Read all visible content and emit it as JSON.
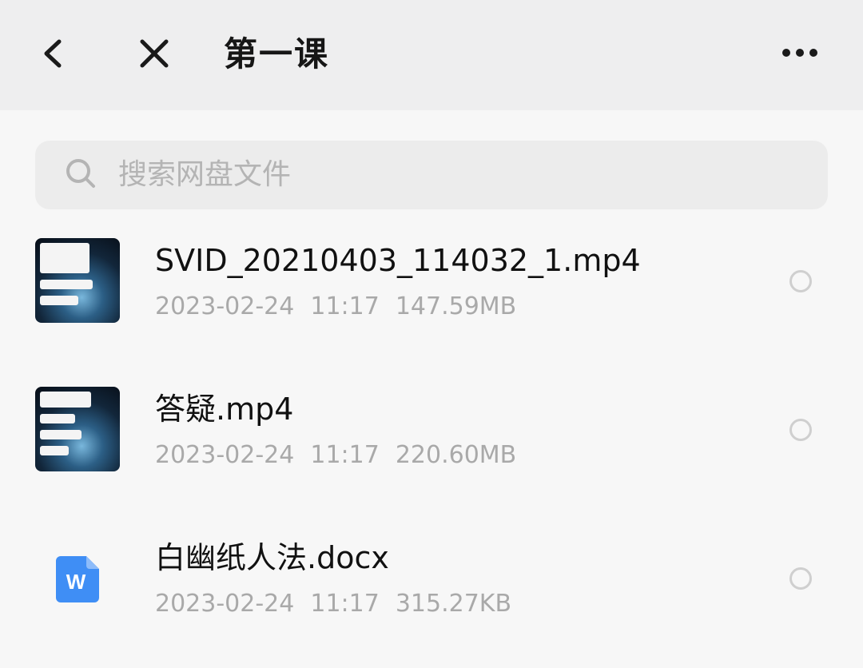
{
  "header": {
    "title": "第一课",
    "back_icon": "chevron-left-icon",
    "close_icon": "close-icon",
    "more_icon": "more-horizontal-icon"
  },
  "search": {
    "placeholder": "搜索网盘文件",
    "icon": "search-icon"
  },
  "files": [
    {
      "name": "SVID_20210403_114032_1.mp4",
      "date": "2023-02-24",
      "time": "11:17",
      "size": "147.59MB",
      "type": "video",
      "thumbnail": "chat-screenshot-thumbnail"
    },
    {
      "name": "答疑.mp4",
      "date": "2023-02-24",
      "time": "11:17",
      "size": "220.60MB",
      "type": "video",
      "thumbnail": "chat-screenshot-thumbnail"
    },
    {
      "name": "白幽纸人法.docx",
      "date": "2023-02-24",
      "time": "11:17",
      "size": "315.27KB",
      "type": "document",
      "icon": "word-doc-icon",
      "icon_letter": "W"
    }
  ],
  "colors": {
    "header_bg": "#eeeeef",
    "page_bg": "#f7f7f7",
    "word_icon": "#3f8ef5",
    "meta_text": "#a9a9a9"
  }
}
